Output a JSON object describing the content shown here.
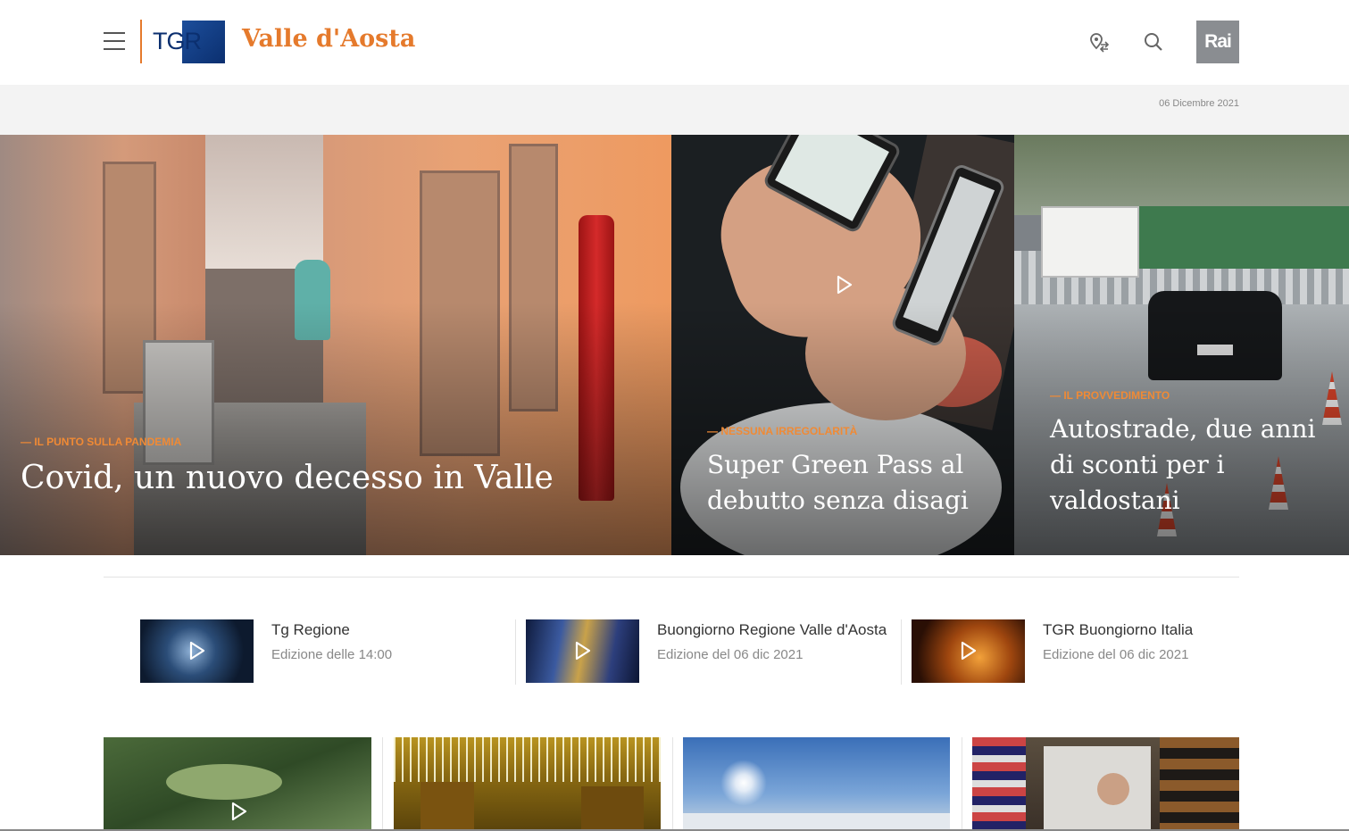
{
  "header": {
    "logo_text": "TGR",
    "region_title": "Valle d'Aosta",
    "brand_logo": "Rai",
    "icons": [
      "menu-icon",
      "location-icon",
      "search-icon"
    ]
  },
  "date_strip": {
    "date": "06 Dicembre 2021"
  },
  "hero": [
    {
      "kicker": "Il punto sulla pandemia",
      "headline": "Covid, un nuovo decesso in Valle",
      "has_video": false
    },
    {
      "kicker": "Nessuna irregolarità",
      "headline": "Super Green Pass al debutto senza disagi",
      "has_video": true
    },
    {
      "kicker": "Il provvedimento",
      "headline": "Autostrade, due anni di sconti per i valdostani",
      "has_video": false
    }
  ],
  "videos": [
    {
      "title": "Tg Regione",
      "subtitle": "Edizione delle 14:00"
    },
    {
      "title": "Buongiorno Regione Valle d'Aosta",
      "subtitle": "Edizione del 06 dic 2021"
    },
    {
      "title": "TGR Buongiorno Italia",
      "subtitle": "Edizione del 06 dic 2021"
    }
  ],
  "colors": {
    "accent": "#e57a2c",
    "kicker": "#f08a35",
    "rai_grey": "#8a8d91",
    "tgr_blue": "#0b2f6f",
    "date_strip_bg": "#f3f3f3"
  }
}
